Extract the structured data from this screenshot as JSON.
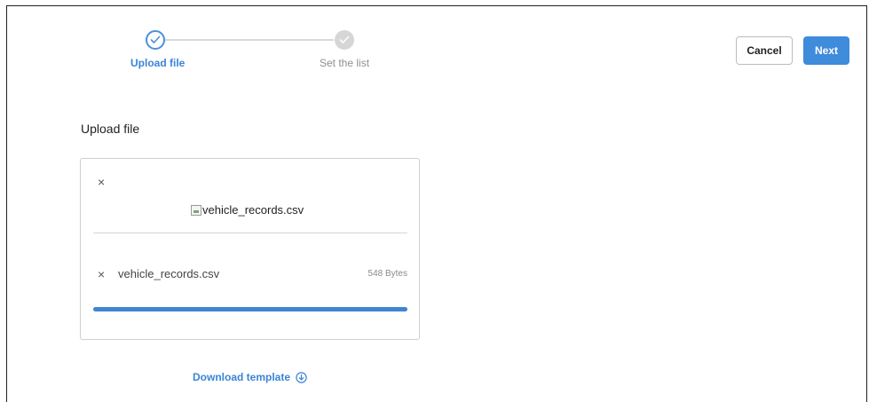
{
  "stepper": {
    "steps": [
      {
        "label": "Upload file",
        "state": "active"
      },
      {
        "label": "Set the list",
        "state": "inactive"
      }
    ]
  },
  "actions": {
    "cancel_label": "Cancel",
    "next_label": "Next"
  },
  "upload": {
    "title": "Upload file",
    "preview_alt": "vehicle_records.csv",
    "file_name": "vehicle_records.csv",
    "file_size": "548 Bytes",
    "remove_glyph": "×",
    "progress": 1.0
  },
  "download": {
    "label": "Download template",
    "icon": "download-circle-icon"
  },
  "colors": {
    "accent": "#3f8bdc",
    "step_inactive": "#d6d6d6",
    "progress": "#3f85d3"
  }
}
